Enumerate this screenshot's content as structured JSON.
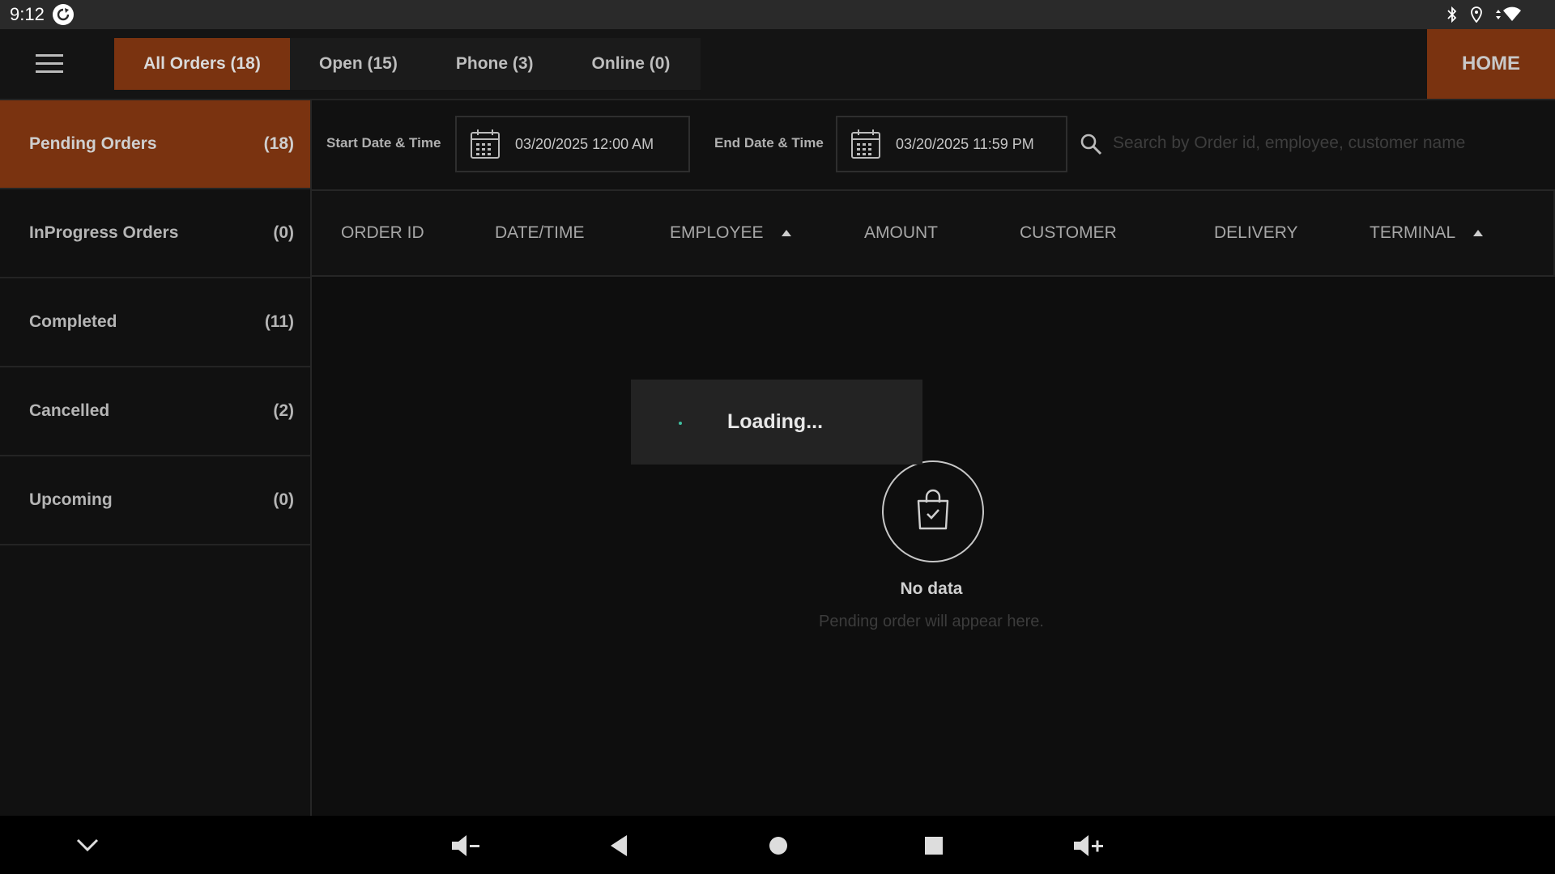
{
  "status_bar": {
    "time": "9:12",
    "icons": [
      "sync-icon",
      "bluetooth-icon",
      "location-icon",
      "wifi-icon"
    ]
  },
  "top_bar": {
    "tabs": [
      {
        "label": "All Orders (18)",
        "active": true
      },
      {
        "label": "Open (15)",
        "active": false
      },
      {
        "label": "Phone (3)",
        "active": false
      },
      {
        "label": "Online (0)",
        "active": false
      }
    ],
    "home_label": "HOME"
  },
  "sidebar": {
    "items": [
      {
        "label": "Pending Orders",
        "count": "(18)",
        "active": true
      },
      {
        "label": "InProgress Orders",
        "count": "(0)",
        "active": false
      },
      {
        "label": "Completed",
        "count": "(11)",
        "active": false
      },
      {
        "label": "Cancelled",
        "count": "(2)",
        "active": false
      },
      {
        "label": "Upcoming",
        "count": "(0)",
        "active": false
      }
    ]
  },
  "filters": {
    "start_label": "Start Date & Time",
    "start_value": "03/20/2025 12:00 AM",
    "end_label": "End Date & Time",
    "end_value": "03/20/2025 11:59 PM",
    "search_placeholder": "Search by Order id, employee, customer name"
  },
  "table": {
    "columns": [
      "ORDER ID",
      "DATE/TIME",
      "EMPLOYEE",
      "AMOUNT",
      "CUSTOMER",
      "DELIVERY",
      "TERMINAL"
    ],
    "sorted_columns": [
      "EMPLOYEE",
      "TERMINAL"
    ]
  },
  "empty_state": {
    "title": "No data",
    "subtitle": "Pending order will appear here."
  },
  "loading": {
    "text": "Loading..."
  },
  "colors": {
    "accent": "#7a3310",
    "background": "#0e0e0e",
    "spinner": "#3fbfa0"
  }
}
